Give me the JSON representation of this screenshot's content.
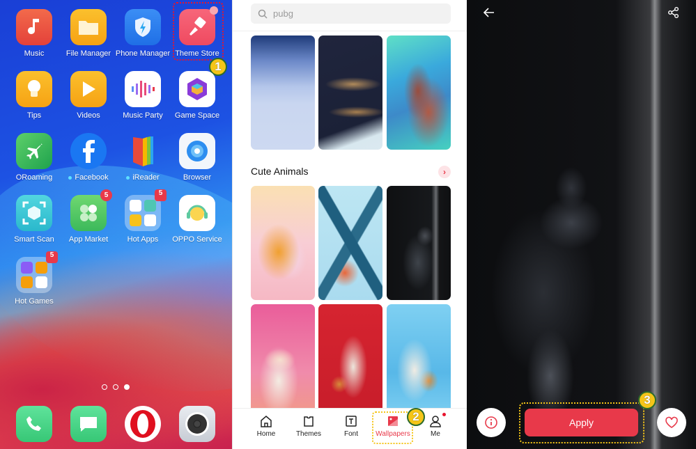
{
  "home_screen": {
    "apps": [
      {
        "label": "Music",
        "icon": "music-note-icon"
      },
      {
        "label": "File Manager",
        "icon": "folder-icon"
      },
      {
        "label": "Phone Manager",
        "icon": "shield-bolt-icon"
      },
      {
        "label": "Theme Store",
        "icon": "paintbrush-icon"
      },
      {
        "label": "Tips",
        "icon": "lightbulb-icon"
      },
      {
        "label": "Videos",
        "icon": "play-icon"
      },
      {
        "label": "Music Party",
        "icon": "sound-wave-icon"
      },
      {
        "label": "Game Space",
        "icon": "cube-icon"
      },
      {
        "label": "ORoaming",
        "icon": "airplane-icon"
      },
      {
        "label": "Facebook",
        "icon": "facebook-icon"
      },
      {
        "label": "iReader",
        "icon": "book-icon"
      },
      {
        "label": "Browser",
        "icon": "browser-icon"
      },
      {
        "label": "Smart Scan",
        "icon": "scan-cube-icon"
      },
      {
        "label": "App Market",
        "icon": "clover-icon",
        "badge": "5"
      },
      {
        "label": "Hot Apps",
        "icon": "folder-apps-icon",
        "badge": "5"
      },
      {
        "label": "OPPO Service",
        "icon": "headset-icon"
      },
      {
        "label": "Hot Games",
        "icon": "folder-games-icon",
        "badge": "5"
      }
    ],
    "dock": [
      {
        "name": "Phone",
        "icon": "phone-icon"
      },
      {
        "name": "Messages",
        "icon": "message-icon"
      },
      {
        "name": "Opera",
        "icon": "opera-icon"
      },
      {
        "name": "Camera",
        "icon": "camera-icon"
      }
    ],
    "page_indicator": {
      "pages": 3,
      "current": 3
    },
    "callout": "1"
  },
  "theme_store": {
    "search": {
      "value": "pubg"
    },
    "section_title": "Cute Animals",
    "nav": [
      {
        "label": "Home",
        "icon": "home-icon"
      },
      {
        "label": "Themes",
        "icon": "shirt-icon"
      },
      {
        "label": "Font",
        "icon": "font-icon"
      },
      {
        "label": "Wallpapers",
        "icon": "wallpaper-icon",
        "active": true
      },
      {
        "label": "Me",
        "icon": "person-icon",
        "notification_dot": true
      }
    ],
    "callout": "2",
    "accent": "#e8394a"
  },
  "preview": {
    "apply_label": "Apply",
    "callout": "3",
    "icons": {
      "back": "arrow-left-icon",
      "share": "share-icon",
      "info": "info-icon",
      "favorite": "heart-icon"
    }
  }
}
